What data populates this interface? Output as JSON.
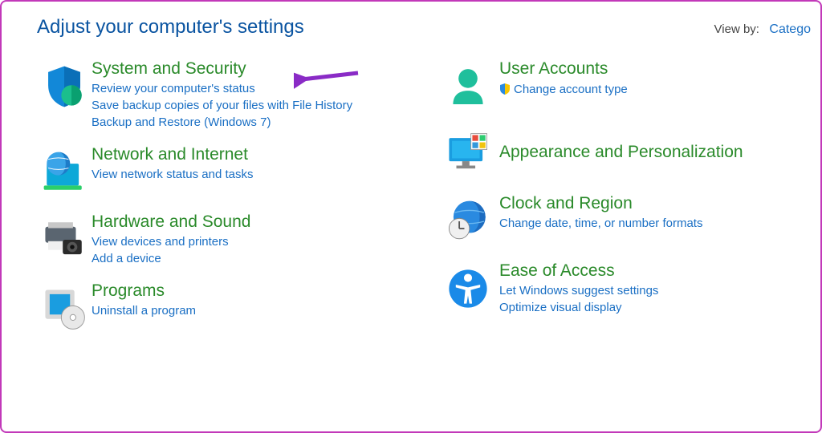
{
  "header": {
    "title": "Adjust your computer's settings",
    "viewby_label": "View by:",
    "viewby_value": "Catego"
  },
  "left": [
    {
      "heading": "System and Security",
      "links": [
        "Review your computer's status",
        "Save backup copies of your files with File History",
        "Backup and Restore (Windows 7)"
      ]
    },
    {
      "heading": "Network and Internet",
      "links": [
        "View network status and tasks"
      ]
    },
    {
      "heading": "Hardware and Sound",
      "links": [
        "View devices and printers",
        "Add a device"
      ]
    },
    {
      "heading": "Programs",
      "links": [
        "Uninstall a program"
      ]
    }
  ],
  "right": [
    {
      "heading": "User Accounts",
      "links": [
        "Change account type"
      ],
      "shield": true
    },
    {
      "heading": "Appearance and Personalization",
      "links": []
    },
    {
      "heading": "Clock and Region",
      "links": [
        "Change date, time, or number formats"
      ]
    },
    {
      "heading": "Ease of Access",
      "links": [
        "Let Windows suggest settings",
        "Optimize visual display"
      ]
    }
  ]
}
